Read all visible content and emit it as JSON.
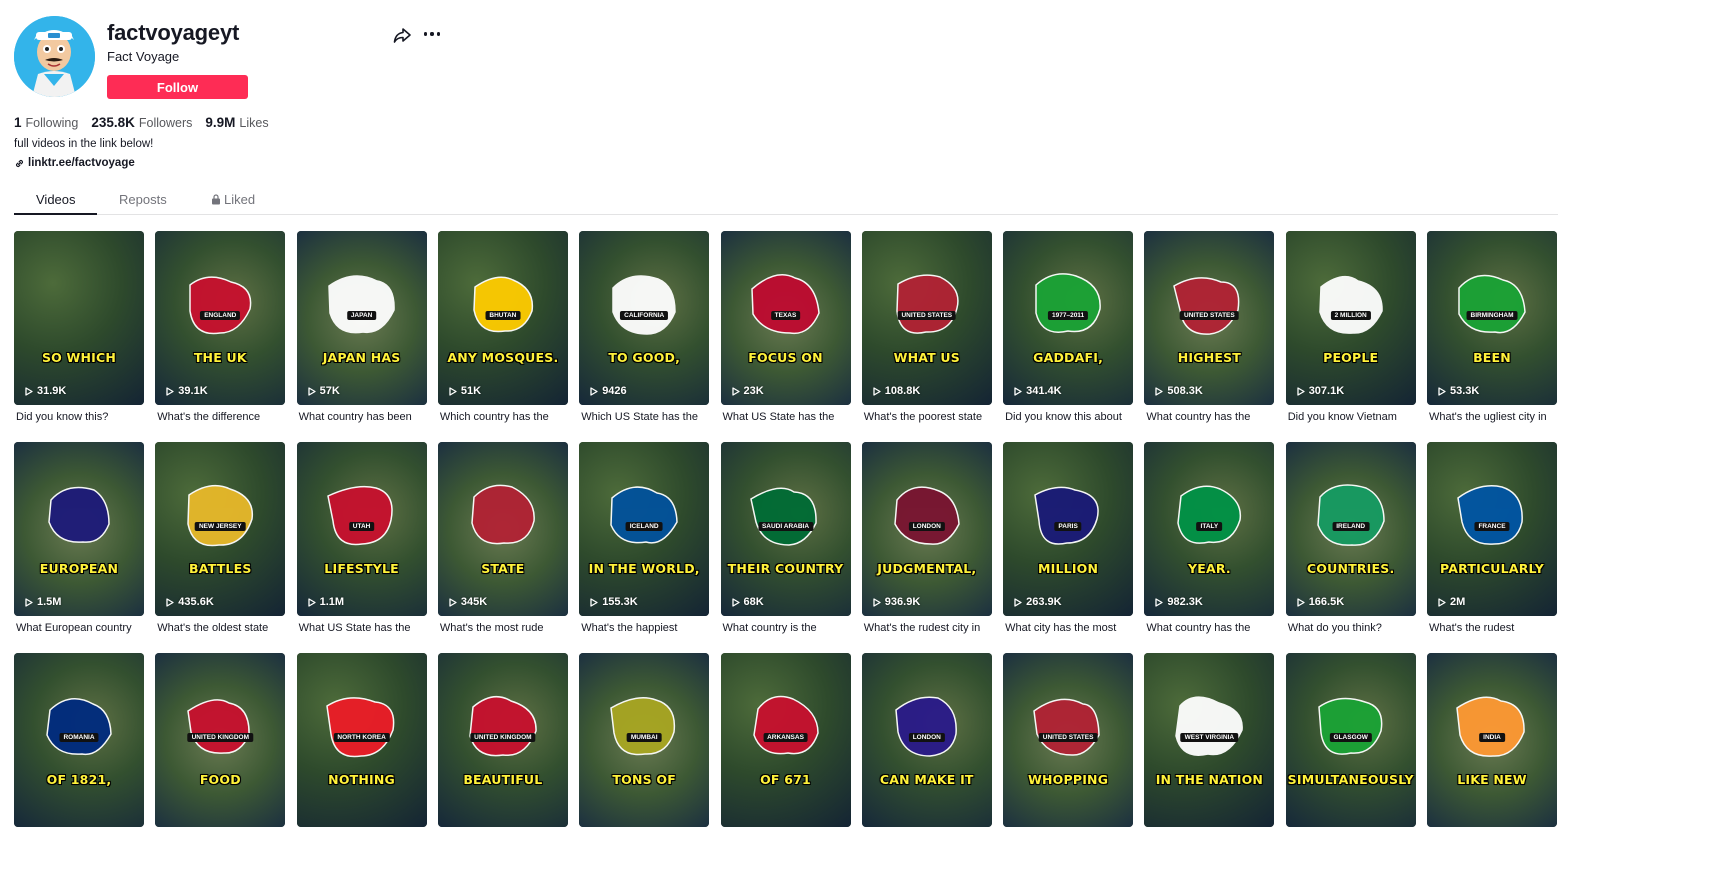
{
  "profile": {
    "username": "factvoyageyt",
    "nickname": "Fact Voyage",
    "follow_label": "Follow",
    "stats": [
      {
        "num": "1",
        "label": "Following"
      },
      {
        "num": "235.8K",
        "label": "Followers"
      },
      {
        "num": "9.9M",
        "label": "Likes"
      }
    ],
    "bio": "full videos in the link below!",
    "link": "linktr.ee/factvoyage"
  },
  "tabs": [
    {
      "label": "Videos"
    },
    {
      "label": "Reposts"
    },
    {
      "label": "Liked"
    }
  ],
  "colors": {
    "accent": "#fe2c55",
    "caption": "#fff23a"
  },
  "videos": [
    {
      "word": "SO WHICH",
      "views": "31.9K",
      "title": "Did you know this?",
      "tag": "",
      "color": "#2f4a2a"
    },
    {
      "word": "THE UK",
      "views": "39.1K",
      "title": "What's the difference",
      "tag": "ENGLAND",
      "color": "#c8102e"
    },
    {
      "word": "JAPAN HAS",
      "views": "57K",
      "title": "What country has been",
      "tag": "JAPAN",
      "color": "#ffffff"
    },
    {
      "word": "ANY MOSQUES.",
      "views": "51K",
      "title": "Which country has the",
      "tag": "BHUTAN",
      "color": "#ffcc00"
    },
    {
      "word": "TO GOOD,",
      "views": "9426",
      "title": "Which US State has the",
      "tag": "CALIFORNIA",
      "color": "#ffffff"
    },
    {
      "word": "FOCUS ON",
      "views": "23K",
      "title": "What US State has the",
      "tag": "TEXAS",
      "color": "#bf0a30"
    },
    {
      "word": "WHAT US",
      "views": "108.8K",
      "title": "What's the poorest state",
      "tag": "UNITED STATES",
      "color": "#b22234"
    },
    {
      "word": "GADDAFI,",
      "views": "341.4K",
      "title": "Did you know this about",
      "tag": "1977–2011",
      "color": "#1aa335"
    },
    {
      "word": "HIGHEST",
      "views": "508.3K",
      "title": "What country has the",
      "tag": "UNITED STATES",
      "color": "#b22234"
    },
    {
      "word": "PEOPLE",
      "views": "307.1K",
      "title": "Did you know Vietnam",
      "tag": "2 MILLION",
      "color": "#ffffff"
    },
    {
      "word": "BEEN",
      "views": "53.3K",
      "title": "What's the ugliest city in",
      "tag": "BIRMINGHAM",
      "color": "#1aa335"
    },
    {
      "word": "EUROPEAN",
      "views": "1.5M",
      "title": "What European country",
      "tag": "",
      "color": "#1d1a7a"
    },
    {
      "word": "BATTLES",
      "views": "435.6K",
      "title": "What's the oldest state",
      "tag": "NEW JERSEY",
      "color": "#e8b92a"
    },
    {
      "word": "LIFESTYLE",
      "views": "1.1M",
      "title": "What US State has the",
      "tag": "UTAH",
      "color": "#c8102e"
    },
    {
      "word": "STATE",
      "views": "345K",
      "title": "What's the most rude",
      "tag": "",
      "color": "#b22234"
    },
    {
      "word": "IN THE WORLD,",
      "views": "155.3K",
      "title": "What's the happiest",
      "tag": "ICELAND",
      "color": "#02529c"
    },
    {
      "word": "THEIR COUNTRY",
      "views": "68K",
      "title": "What country is the",
      "tag": "SAUDI ARABIA",
      "color": "#006c35"
    },
    {
      "word": "JUDGMENTAL,",
      "views": "936.9K",
      "title": "What's the rudest city in",
      "tag": "LONDON",
      "color": "#7a1431"
    },
    {
      "word": "MILLION",
      "views": "263.9K",
      "title": "What city has the most",
      "tag": "PARIS",
      "color": "#1a1a78"
    },
    {
      "word": "YEAR.",
      "views": "982.3K",
      "title": "What country has the",
      "tag": "ITALY",
      "color": "#009246"
    },
    {
      "word": "COUNTRIES.",
      "views": "166.5K",
      "title": "What do you think?",
      "tag": "IRELAND",
      "color": "#169b62"
    },
    {
      "word": "PARTICULARLY",
      "views": "2M",
      "title": "What's the rudest",
      "tag": "FRANCE",
      "color": "#0055a4"
    },
    {
      "word": "OF 1821,",
      "views": "",
      "title": "",
      "tag": "ROMANIA",
      "color": "#002b7f"
    },
    {
      "word": "FOOD",
      "views": "",
      "title": "",
      "tag": "UNITED KINGDOM",
      "color": "#c8102e"
    },
    {
      "word": "NOTHING",
      "views": "",
      "title": "",
      "tag": "NORTH KOREA",
      "color": "#ed1c27"
    },
    {
      "word": "BEAUTIFUL",
      "views": "",
      "title": "",
      "tag": "UNITED KINGDOM",
      "color": "#c8102e"
    },
    {
      "word": "TONS OF",
      "views": "",
      "title": "",
      "tag": "MUMBAI",
      "color": "#a8a622"
    },
    {
      "word": "OF 671",
      "views": "",
      "title": "",
      "tag": "ARKANSAS",
      "color": "#c8102e"
    },
    {
      "word": "CAN MAKE IT",
      "views": "",
      "title": "",
      "tag": "LONDON",
      "color": "#2a1a8a"
    },
    {
      "word": "WHOPPING",
      "views": "",
      "title": "",
      "tag": "UNITED STATES",
      "color": "#b22234"
    },
    {
      "word": "IN THE NATION",
      "views": "",
      "title": "",
      "tag": "WEST VIRGINIA",
      "color": "#ffffff"
    },
    {
      "word": "SIMULTANEOUSLY",
      "views": "",
      "title": "",
      "tag": "GLASGOW",
      "color": "#1aa335"
    },
    {
      "word": "LIKE NEW",
      "views": "",
      "title": "",
      "tag": "INDIA",
      "color": "#ff9933"
    }
  ]
}
